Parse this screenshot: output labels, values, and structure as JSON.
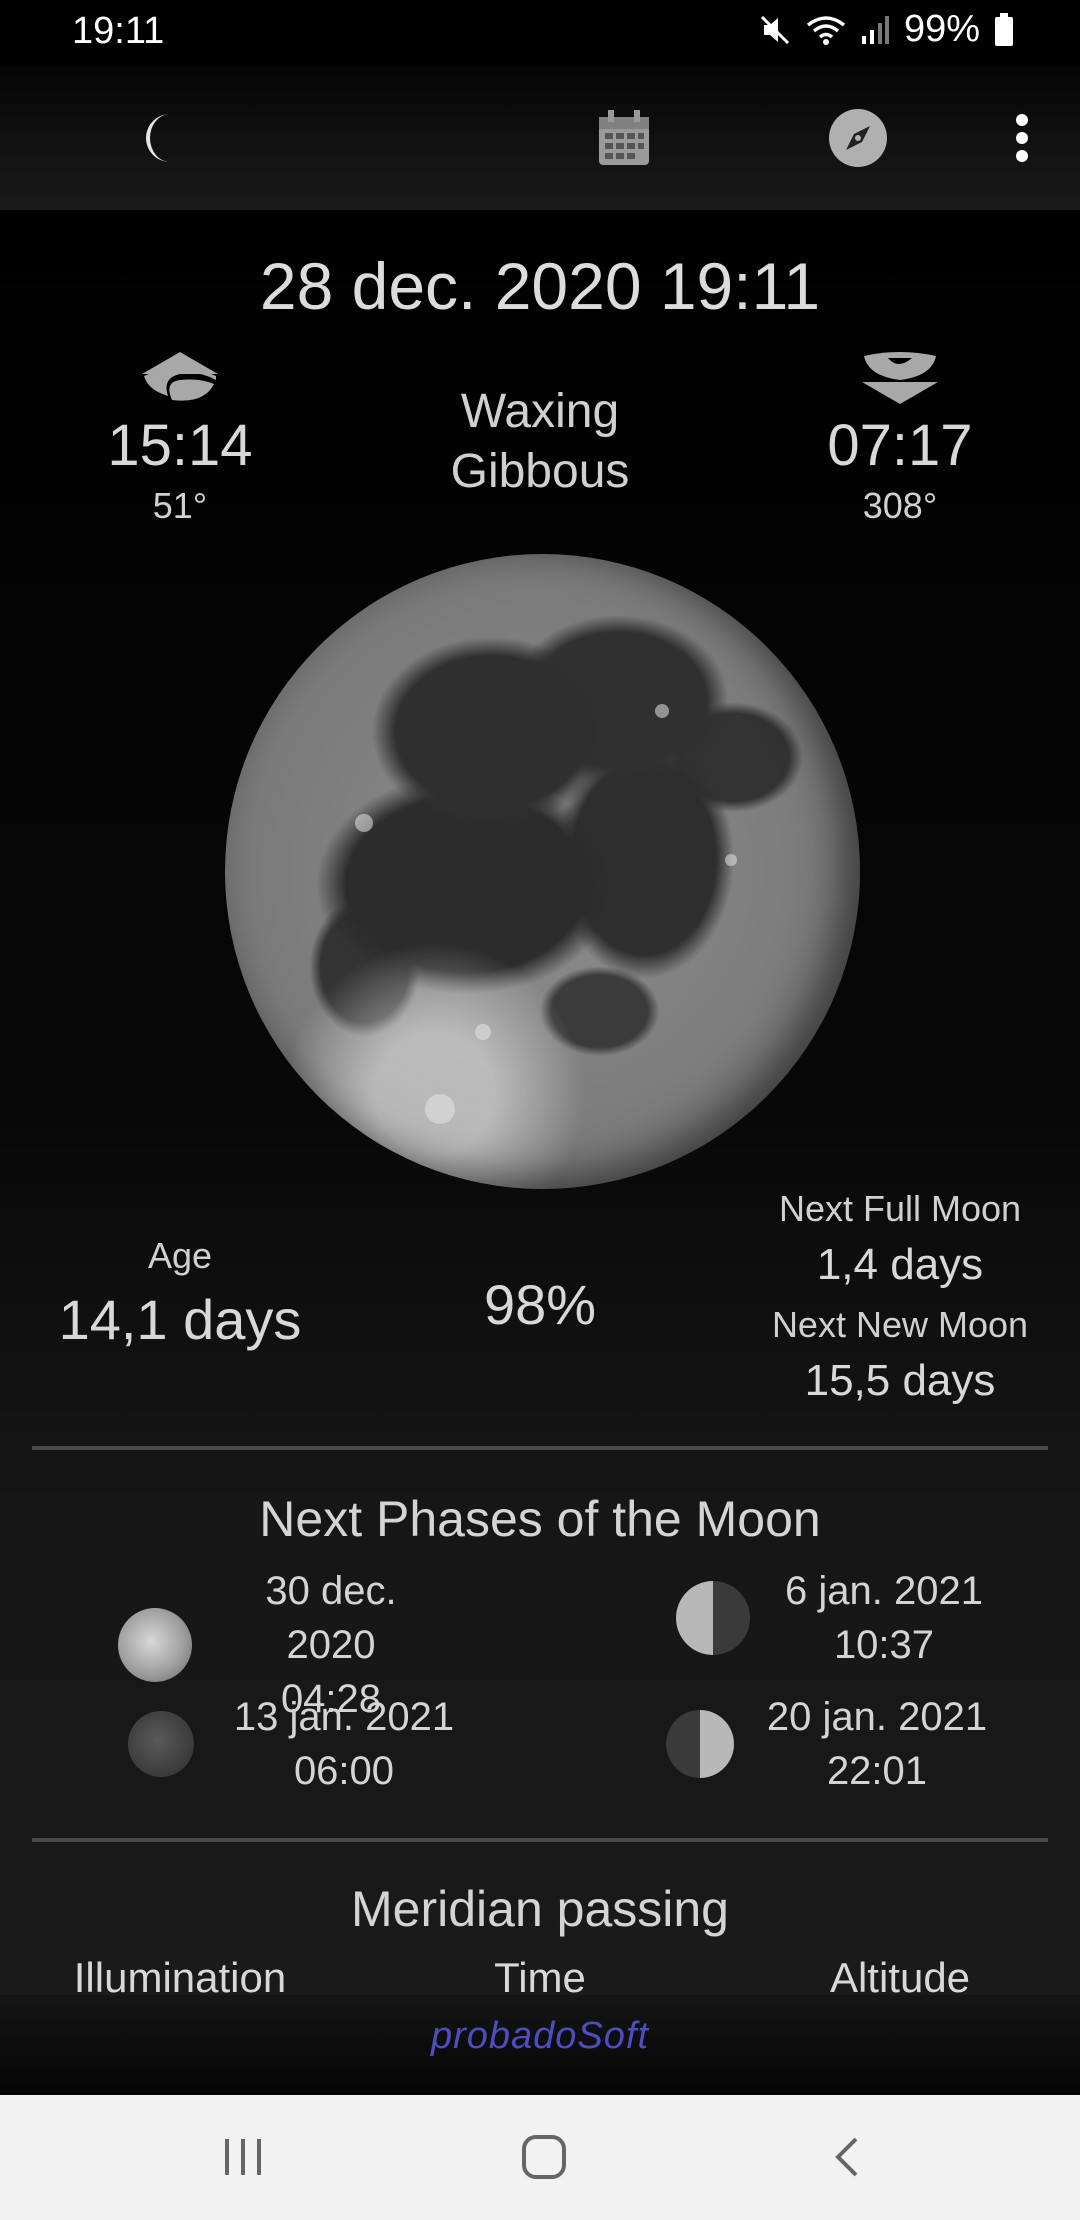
{
  "status_bar": {
    "time": "19:11",
    "battery": "99%"
  },
  "app_bar": {
    "icons": [
      "moon-icon",
      "calendar-icon",
      "compass-icon",
      "more-vert-icon"
    ]
  },
  "main": {
    "datetime": "28 dec. 2020 19:11",
    "moonrise": {
      "time": "15:14",
      "azimuth": "51°"
    },
    "phase_name_line1": "Waxing",
    "phase_name_line2": "Gibbous",
    "moonset": {
      "time": "07:17",
      "azimuth": "308°"
    },
    "age_label": "Age",
    "age_value": "14,1 days",
    "illumination": "98%",
    "next_full_label": "Next Full Moon",
    "next_full_value": "1,4 days",
    "next_new_label": "Next New Moon",
    "next_new_value": "15,5 days"
  },
  "next_phases": {
    "title": "Next Phases of the Moon",
    "items": [
      {
        "date": "30 dec. 2020",
        "time": "04:28",
        "icon": "full-moon-icon"
      },
      {
        "date": "6 jan. 2021",
        "time": "10:37",
        "icon": "last-quarter-icon"
      },
      {
        "date": "13 jan. 2021",
        "time": "06:00",
        "icon": "new-moon-icon"
      },
      {
        "date": "20 jan. 2021",
        "time": "22:01",
        "icon": "first-quarter-icon"
      }
    ]
  },
  "meridian": {
    "title": "Meridian passing",
    "col_illumination": "Illumination",
    "col_time": "Time",
    "col_altitude": "Altitude"
  },
  "footer": {
    "brand": "probadoSoft"
  },
  "colors": {
    "brand": "#4d4dbf",
    "background": "#000000",
    "text": "#d6d6d6"
  }
}
